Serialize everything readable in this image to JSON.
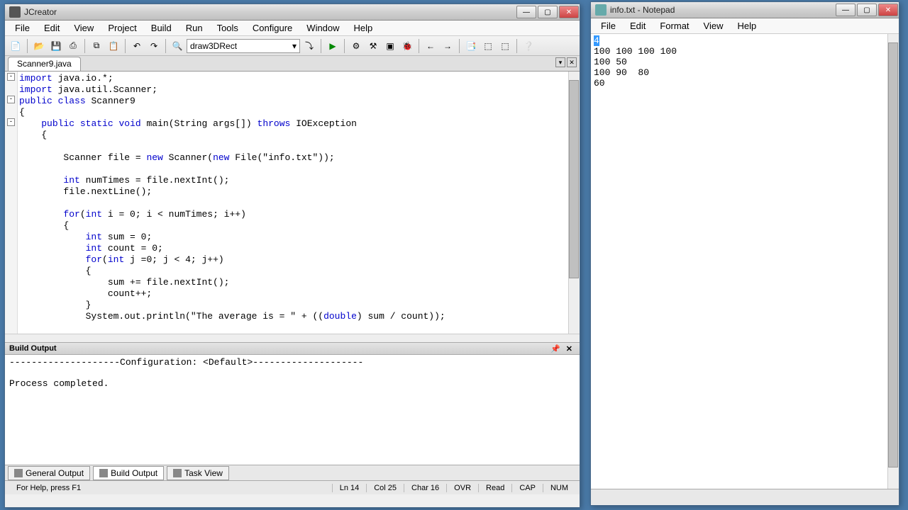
{
  "jcreator": {
    "title": "JCreator",
    "menu": [
      "File",
      "Edit",
      "View",
      "Project",
      "Build",
      "Run",
      "Tools",
      "Configure",
      "Window",
      "Help"
    ],
    "combo": "draw3DRect",
    "tab": "Scanner9.java",
    "code_lines": [
      {
        "t": "import java.io.*;",
        "fold": "-"
      },
      {
        "t": "import java.util.Scanner;"
      },
      {
        "t": "public class Scanner9",
        "fold": "-"
      },
      {
        "t": "{"
      },
      {
        "t": "    public static void main(String args[]) throws IOException",
        "fold": "-"
      },
      {
        "t": "    {"
      },
      {
        "t": ""
      },
      {
        "t": "        Scanner file = new Scanner(new File(\"info.txt\"));"
      },
      {
        "t": ""
      },
      {
        "t": "        int numTimes = file.nextInt();"
      },
      {
        "t": "        file.nextLine();"
      },
      {
        "t": ""
      },
      {
        "t": "        for(int i = 0; i < numTimes; i++)"
      },
      {
        "t": "        {"
      },
      {
        "t": "            int sum = 0;"
      },
      {
        "t": "            int count = 0;"
      },
      {
        "t": "            for(int j =0; j < 4; j++)"
      },
      {
        "t": "            {"
      },
      {
        "t": "                sum += file.nextInt();"
      },
      {
        "t": "                count++;"
      },
      {
        "t": "            }"
      },
      {
        "t": "            System.out.println(\"The average is = \" + ((double) sum / count));"
      }
    ],
    "panel_title": "Build Output",
    "output": "--------------------Configuration: <Default>--------------------\n\nProcess completed.",
    "bottom_tabs": [
      "General Output",
      "Build Output",
      "Task View"
    ],
    "status": {
      "help": "For Help, press F1",
      "ln": "Ln 14",
      "col": "Col 25",
      "char": "Char 16",
      "ovr": "OVR",
      "read": "Read",
      "cap": "CAP",
      "num": "NUM"
    }
  },
  "notepad": {
    "title": "info.txt - Notepad",
    "menu": [
      "File",
      "Edit",
      "Format",
      "View",
      "Help"
    ],
    "first_char": "4",
    "content": "\n100 100 100 100\n100 50\n100 90  80\n60"
  }
}
